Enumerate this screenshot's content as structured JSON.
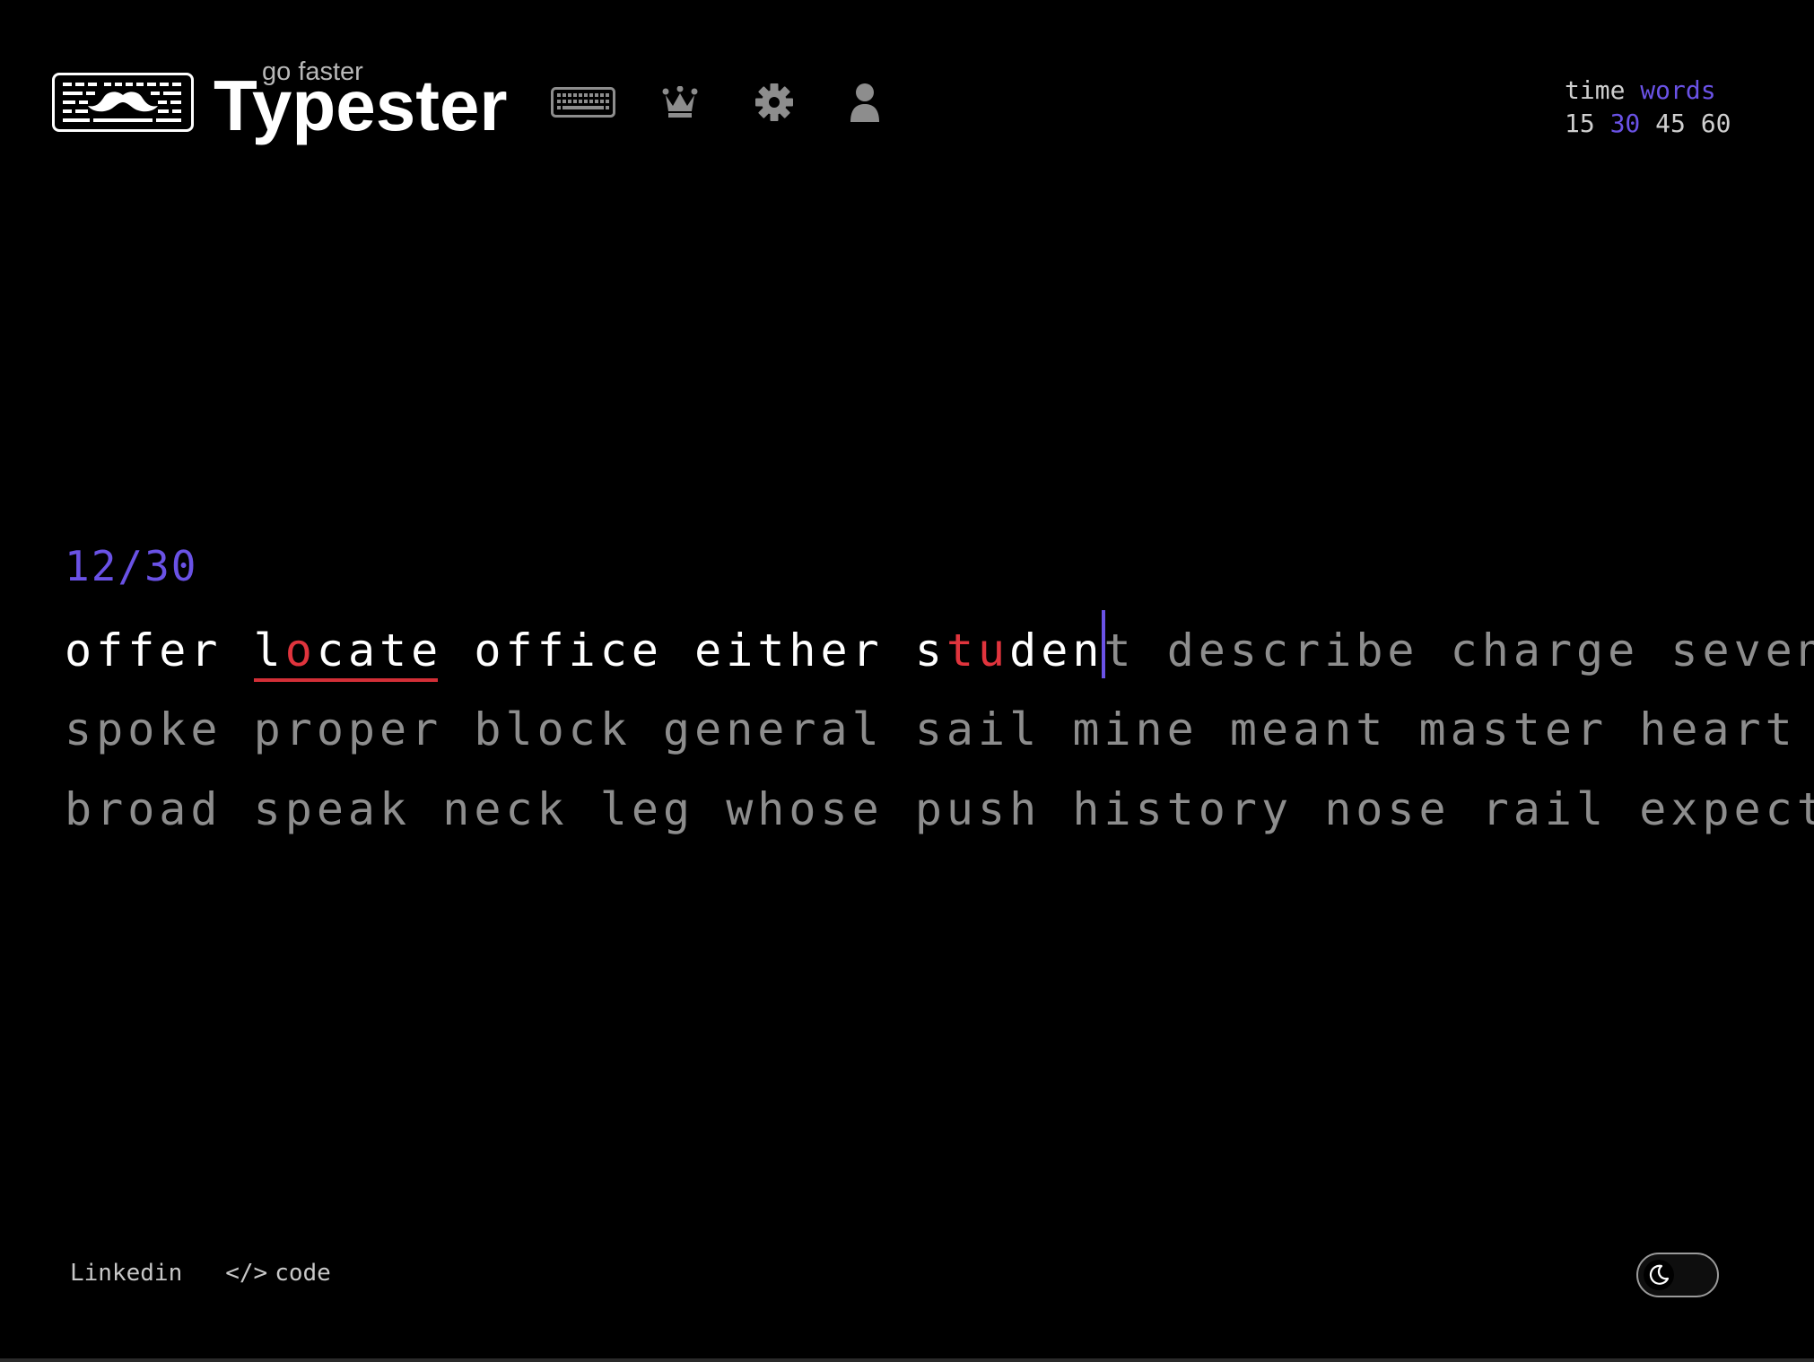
{
  "header": {
    "tagline": "go faster",
    "title": "Typester",
    "logo_icon": "mustache-keyboard-logo",
    "nav": [
      {
        "icon": "keyboard-icon"
      },
      {
        "icon": "crown-icon"
      },
      {
        "icon": "gear-icon"
      },
      {
        "icon": "user-icon"
      }
    ]
  },
  "mode": {
    "types": [
      "time",
      "words"
    ],
    "active_type": "words",
    "amounts": [
      "15",
      "30",
      "45",
      "60"
    ],
    "active_amount": "30"
  },
  "test": {
    "progress": "12/30",
    "lines": [
      [
        {
          "chars": [
            {
              "c": "offer",
              "s": "typed"
            }
          ]
        },
        {
          "wrong": true,
          "chars": [
            {
              "c": "l",
              "s": "typed"
            },
            {
              "c": "o",
              "s": "err"
            },
            {
              "c": "cate",
              "s": "typed"
            }
          ]
        },
        {
          "chars": [
            {
              "c": "office",
              "s": "typed"
            }
          ]
        },
        {
          "chars": [
            {
              "c": "either",
              "s": "typed"
            }
          ]
        },
        {
          "chars": [
            {
              "c": "s",
              "s": "typed"
            },
            {
              "c": "tu",
              "s": "err"
            },
            {
              "c": "den",
              "s": "typed"
            },
            {
              "c": "|",
              "s": "caret"
            },
            {
              "c": "t",
              "s": "pending"
            }
          ]
        },
        {
          "chars": [
            {
              "c": "describe",
              "s": "pending"
            }
          ]
        },
        {
          "chars": [
            {
              "c": "charge",
              "s": "pending"
            }
          ]
        },
        {
          "chars": [
            {
              "c": "seven",
              "s": "pending"
            }
          ]
        }
      ],
      [
        {
          "chars": [
            {
              "c": "spoke",
              "s": "pending"
            }
          ]
        },
        {
          "chars": [
            {
              "c": "proper",
              "s": "pending"
            }
          ]
        },
        {
          "chars": [
            {
              "c": "block",
              "s": "pending"
            }
          ]
        },
        {
          "chars": [
            {
              "c": "general",
              "s": "pending"
            }
          ]
        },
        {
          "chars": [
            {
              "c": "sail",
              "s": "pending"
            }
          ]
        },
        {
          "chars": [
            {
              "c": "mine",
              "s": "pending"
            }
          ]
        },
        {
          "chars": [
            {
              "c": "meant",
              "s": "pending"
            }
          ]
        },
        {
          "chars": [
            {
              "c": "master",
              "s": "pending"
            }
          ]
        },
        {
          "chars": [
            {
              "c": "heart",
              "s": "pending"
            }
          ]
        }
      ],
      [
        {
          "chars": [
            {
              "c": "broad",
              "s": "pending"
            }
          ]
        },
        {
          "chars": [
            {
              "c": "speak",
              "s": "pending"
            }
          ]
        },
        {
          "chars": [
            {
              "c": "neck",
              "s": "pending"
            }
          ]
        },
        {
          "chars": [
            {
              "c": "leg",
              "s": "pending"
            }
          ]
        },
        {
          "chars": [
            {
              "c": "whose",
              "s": "pending"
            }
          ]
        },
        {
          "chars": [
            {
              "c": "push",
              "s": "pending"
            }
          ]
        },
        {
          "chars": [
            {
              "c": "history",
              "s": "pending"
            }
          ]
        },
        {
          "chars": [
            {
              "c": "nose",
              "s": "pending"
            }
          ]
        },
        {
          "chars": [
            {
              "c": "rail",
              "s": "pending"
            }
          ]
        },
        {
          "chars": [
            {
              "c": "expect",
              "s": "pending"
            }
          ]
        }
      ]
    ]
  },
  "footer": {
    "linkedin_label": "Linkedin",
    "code_glyph": "</>",
    "code_label": "code",
    "theme_toggle_icon": "moon-icon"
  },
  "colors": {
    "background": "#000000",
    "accent": "#6a52e6",
    "error": "#e0343d",
    "typed": "#ffffff",
    "pending": "#8d8d8d"
  }
}
